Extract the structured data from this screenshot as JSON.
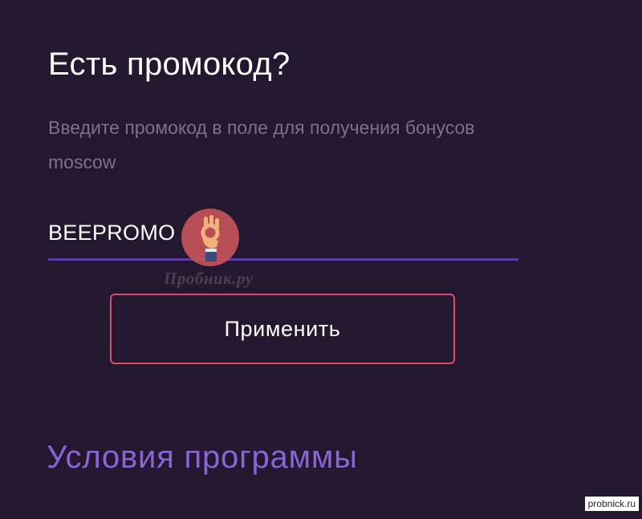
{
  "promo": {
    "title": "Есть промокод?",
    "description": "Введите промокод в поле для получения бонусов moscow",
    "input_value": "BEEPROMO",
    "apply_label": "Применить"
  },
  "terms": {
    "link_label": "Условия программы"
  },
  "watermark": {
    "text": "Пробник.ру",
    "site": "probnick.ru"
  },
  "colors": {
    "background": "#231830",
    "accent_underline": "#5b3aa6",
    "button_border": "#e2486d",
    "link": "#8b63d6",
    "muted_text": "#7b7285"
  }
}
